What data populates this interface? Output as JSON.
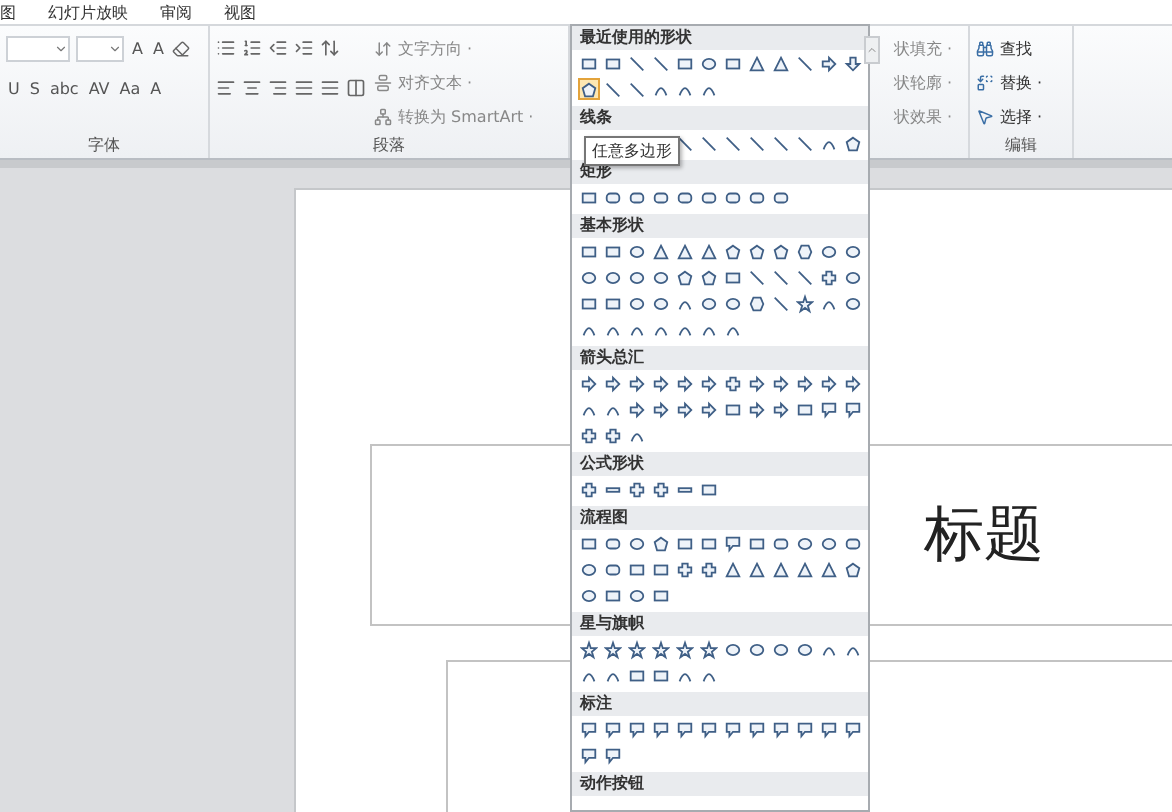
{
  "menu_tabs": [
    {
      "label": "图",
      "selected": false
    },
    {
      "label": "幻灯片放映",
      "selected": false
    },
    {
      "label": "审阅",
      "selected": false
    },
    {
      "label": "视图",
      "selected": false
    }
  ],
  "font_group": {
    "label": "字体",
    "size_buttons": [
      "A",
      "A"
    ],
    "format_buttons": [
      "U",
      "S",
      "abc",
      "AV",
      "Aa",
      "A"
    ]
  },
  "paragraph_group": {
    "label": "段落",
    "commands": [
      "文字方向 ·",
      "对齐文本 ·",
      "转换为 SmartArt ·"
    ]
  },
  "drawing_group": {
    "commands": [
      "状填充 ·",
      "状轮廓 ·",
      "状效果 ·"
    ]
  },
  "editing_group": {
    "label": "编辑",
    "commands": [
      "查找",
      "替换 ·",
      "选择 ·"
    ]
  },
  "shapes_gallery": {
    "tooltip": "任意多边形",
    "sections": [
      {
        "title": "最近使用的形状",
        "shapes": [
          {
            "selected": false
          },
          {
            "selected": false
          },
          {
            "selected": false
          },
          {
            "selected": false
          },
          {
            "selected": false
          },
          {
            "selected": false
          },
          {
            "selected": false
          },
          {
            "selected": false
          },
          {
            "selected": false
          },
          {
            "selected": false
          },
          {
            "selected": false
          },
          {
            "selected": false
          },
          {
            "selected": true
          },
          {
            "selected": false
          },
          {
            "selected": false
          },
          {
            "selected": false
          },
          {
            "selected": false
          },
          {
            "selected": false
          }
        ]
      },
      {
        "title": "线条"
      },
      {
        "title": "矩形"
      },
      {
        "title": "基本形状"
      },
      {
        "title": "箭头总汇"
      },
      {
        "title": "公式形状"
      },
      {
        "title": "流程图"
      },
      {
        "title": "星与旗帜"
      },
      {
        "title": "标注"
      },
      {
        "title": "动作按钮"
      }
    ]
  },
  "slide": {
    "title_visible": "标题"
  }
}
